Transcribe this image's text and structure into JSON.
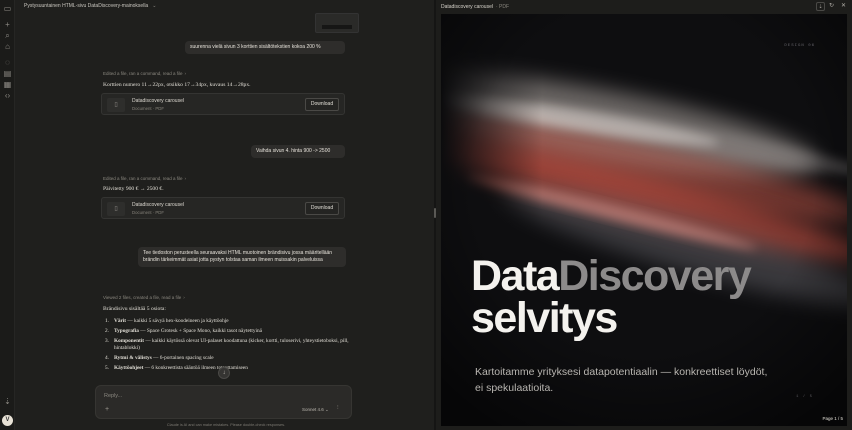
{
  "chat": {
    "title": "Pystysuuntainen HTML-sivu DataDiscovery-mainoksella",
    "messages": {
      "user1": "suurenna vielä sivun 3 korttien sisältötekstien kokoa 200 %",
      "meta1": "Edited a file, ran a command, read a file",
      "reply1": "Korttien numero 11→22px, otsikko 17→34px, kuvaus 14→28px.",
      "user2": "Vaihda sivun 4. hinta 900 -> 2500",
      "meta2": "Edited a file, ran a command, read a file",
      "reply2": "Päivitetty 900 € → 2500 €.",
      "user3": "Tee tiedoston perusteella seuraavaksi HTML muotoinen brändisivu jossa määritellään brändin tärkeimmät asiat jotta pystyn tolstaa saman ilmeen muissakin palveluissa",
      "meta3": "Viewed 2 files, created a file, read a file",
      "reply3_intro": "Brändisivu sisältää 5 osiota:"
    },
    "file_card": {
      "title": "Datadiscovery carousel",
      "subtitle": "Document · PDF",
      "download_label": "Download"
    },
    "list": [
      {
        "n": "1.",
        "bold": "Värit",
        "rest": " — kaikki 5 sävyä hex-koodeineen ja käyttöohje"
      },
      {
        "n": "2.",
        "bold": "Typografia",
        "rest": " — Space Grotesk + Space Mono, kaikki tasot näytettyinä"
      },
      {
        "n": "3.",
        "bold": "Komponentit",
        "rest": " — kaikki käytössä olevat UI-palaset koodattuna (kicker, kortti, tuloserivi, yhteystietoboksi, pill, hintablokki)"
      },
      {
        "n": "4.",
        "bold": "Rytmi & välistys",
        "rest": " — 6-portainen spacing scale"
      },
      {
        "n": "5.",
        "bold": "Käyttöohjeet",
        "rest": " — 6 konkreettista sääntöä ilmeen toteuttamiseen"
      }
    ],
    "composer": {
      "placeholder": "Reply...",
      "model": "Sonnet 4.6"
    },
    "disclaimer": "Claude is AI and can make mistakes. Please double-check responses.",
    "avatar_letter": "V"
  },
  "panel": {
    "title": "Datadiscovery carousel",
    "type": "· PDF",
    "slide": {
      "design_label": "DESIGN 06",
      "headline_bright": "Data",
      "headline_dim": "Discovery",
      "headline_line2": "selvitys",
      "subtitle": "Kartoitamme yrityksesi datapotentiaalin — konkreettiset löydöt, ei spekulaatioita.",
      "slide_count": "1 / 5",
      "page_indicator": "Page 1 / 5"
    }
  },
  "icons": {
    "rail": [
      "sidebar-toggle-icon",
      "new-chat-icon",
      "search-icon",
      "customize-icon",
      "chats-icon",
      "projects-icon",
      "artifacts-icon",
      "code-icon",
      "download-app-icon"
    ],
    "accent": "#d0543e"
  }
}
